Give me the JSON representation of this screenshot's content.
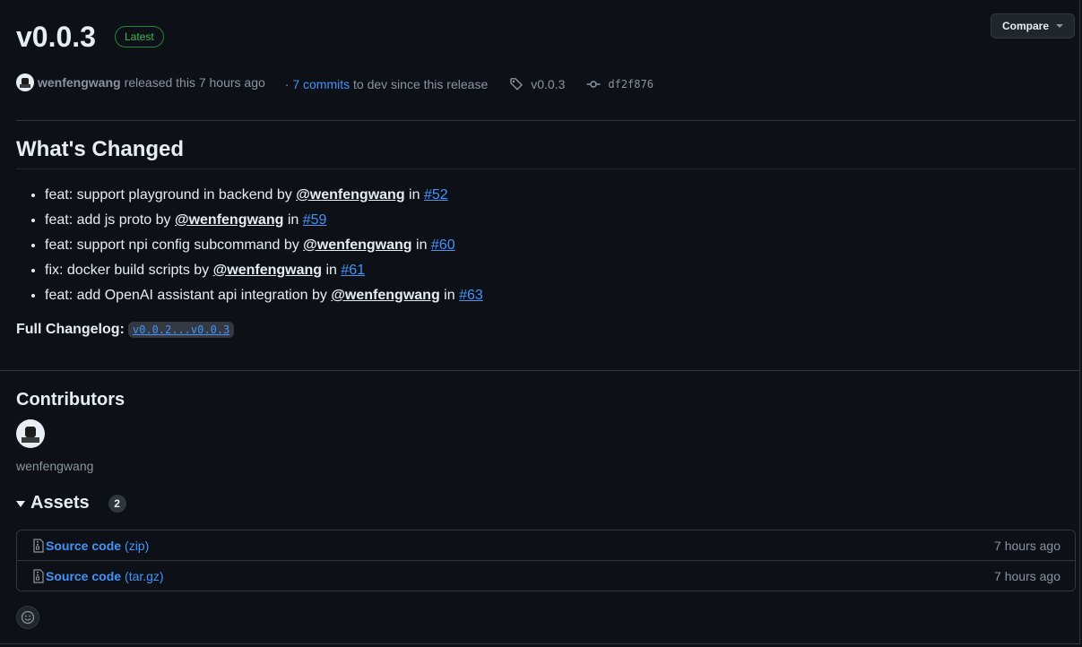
{
  "release": {
    "title": "v0.0.3",
    "latest_badge": "Latest",
    "compare_label": "Compare",
    "author": "wenfengwang",
    "released_text": "released this 7 hours ago",
    "commits_prefix": "·",
    "commits_link": "7 commits",
    "commits_suffix": "to dev since this release",
    "tag": "v0.0.3",
    "commit_sha": "df2f876"
  },
  "changes": {
    "heading": "What's Changed",
    "items": [
      {
        "text": "feat: support playground in backend by",
        "mention": "@wenfengwang",
        "in": "in",
        "pr": "#52"
      },
      {
        "text": "feat: add js proto by",
        "mention": "@wenfengwang",
        "in": "in",
        "pr": "#59"
      },
      {
        "text": "feat: support npi config subcommand by",
        "mention": "@wenfengwang",
        "in": "in",
        "pr": "#60"
      },
      {
        "text": "fix: docker build scripts by",
        "mention": "@wenfengwang",
        "in": "in",
        "pr": "#61"
      },
      {
        "text": "feat: add OpenAI assistant api integration by",
        "mention": "@wenfengwang",
        "in": "in",
        "pr": "#63"
      }
    ],
    "changelog_label": "Full Changelog:",
    "changelog_link": "v0.0.2...v0.0.3"
  },
  "contributors": {
    "heading": "Contributors",
    "names": [
      "wenfengwang"
    ]
  },
  "assets": {
    "heading": "Assets",
    "count": "2",
    "items": [
      {
        "name": "Source code",
        "ext": "(zip)",
        "time": "7 hours ago"
      },
      {
        "name": "Source code",
        "ext": "(tar.gz)",
        "time": "7 hours ago"
      }
    ]
  },
  "icons": {
    "tag": "tag-icon",
    "commit": "git-commit-icon",
    "file_zip": "file-zip-icon",
    "smiley": "smiley-icon"
  },
  "colors": {
    "background": "#0d1117",
    "link": "#4493f8",
    "latest": "#3fb950",
    "muted": "#8b949e"
  }
}
